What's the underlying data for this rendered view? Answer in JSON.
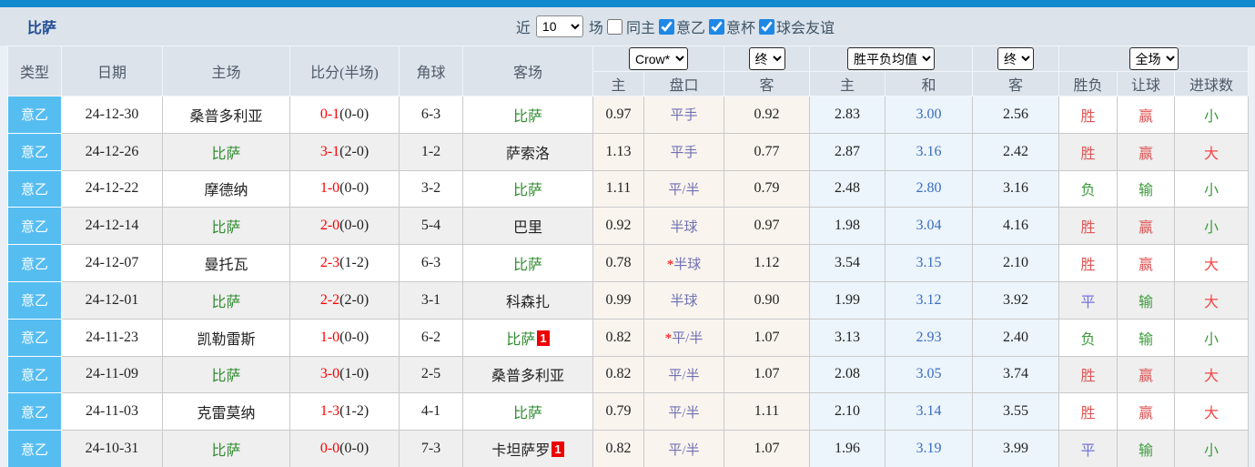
{
  "page": {
    "title": "比萨"
  },
  "filter_bar": {
    "recent_label": "近",
    "recent_value": "10",
    "matches_label": "场",
    "same_home_label": "同主",
    "same_home_checked": false,
    "leagues": [
      {
        "label": "意乙",
        "checked": true
      },
      {
        "label": "意杯",
        "checked": true
      },
      {
        "label": "球会友谊",
        "checked": true
      }
    ]
  },
  "header_controls": {
    "odds_source": "Crow*",
    "final_label_1": "终",
    "avg_label": "胜平负均值",
    "final_label_2": "终",
    "scope_label": "全场"
  },
  "table": {
    "main_headers": [
      "类型",
      "日期",
      "主场",
      "比分(半场)",
      "角球",
      "客场"
    ],
    "sub_headers": [
      "主",
      "盘口",
      "客",
      "主",
      "和",
      "客",
      "胜负",
      "让球",
      "进球数"
    ],
    "rows": [
      {
        "type": "意乙",
        "date": "24-12-30",
        "home": "桑普多利亚",
        "home_pisa": false,
        "home_badge": "",
        "score": "0-1",
        "half": "(0-0)",
        "corner": "6-3",
        "away": "比萨",
        "away_pisa": true,
        "away_badge": "",
        "odds_home": "0.97",
        "handicap": "平手",
        "handicap_star": false,
        "odds_away": "0.92",
        "avg_home": "2.83",
        "avg_draw": "3.00",
        "avg_away": "2.56",
        "result": "胜",
        "handicap_result": "赢",
        "goals_result": "小"
      },
      {
        "type": "意乙",
        "date": "24-12-26",
        "home": "比萨",
        "home_pisa": true,
        "home_badge": "",
        "score": "3-1",
        "half": "(2-0)",
        "corner": "1-2",
        "away": "萨索洛",
        "away_pisa": false,
        "away_badge": "",
        "odds_home": "1.13",
        "handicap": "平手",
        "handicap_star": false,
        "odds_away": "0.77",
        "avg_home": "2.87",
        "avg_draw": "3.16",
        "avg_away": "2.42",
        "result": "胜",
        "handicap_result": "赢",
        "goals_result": "大"
      },
      {
        "type": "意乙",
        "date": "24-12-22",
        "home": "摩德纳",
        "home_pisa": false,
        "home_badge": "",
        "score": "1-0",
        "half": "(0-0)",
        "corner": "3-2",
        "away": "比萨",
        "away_pisa": true,
        "away_badge": "",
        "odds_home": "1.11",
        "handicap": "平/半",
        "handicap_star": false,
        "odds_away": "0.79",
        "avg_home": "2.48",
        "avg_draw": "2.80",
        "avg_away": "3.16",
        "result": "负",
        "handicap_result": "输",
        "goals_result": "小"
      },
      {
        "type": "意乙",
        "date": "24-12-14",
        "home": "比萨",
        "home_pisa": true,
        "home_badge": "",
        "score": "2-0",
        "half": "(0-0)",
        "corner": "5-4",
        "away": "巴里",
        "away_pisa": false,
        "away_badge": "",
        "odds_home": "0.92",
        "handicap": "半球",
        "handicap_star": false,
        "odds_away": "0.97",
        "avg_home": "1.98",
        "avg_draw": "3.04",
        "avg_away": "4.16",
        "result": "胜",
        "handicap_result": "赢",
        "goals_result": "小"
      },
      {
        "type": "意乙",
        "date": "24-12-07",
        "home": "曼托瓦",
        "home_pisa": false,
        "home_badge": "",
        "score": "2-3",
        "half": "(1-2)",
        "corner": "6-3",
        "away": "比萨",
        "away_pisa": true,
        "away_badge": "",
        "odds_home": "0.78",
        "handicap": "半球",
        "handicap_star": true,
        "odds_away": "1.12",
        "avg_home": "3.54",
        "avg_draw": "3.15",
        "avg_away": "2.10",
        "result": "胜",
        "handicap_result": "赢",
        "goals_result": "大"
      },
      {
        "type": "意乙",
        "date": "24-12-01",
        "home": "比萨",
        "home_pisa": true,
        "home_badge": "",
        "score": "2-2",
        "half": "(2-0)",
        "corner": "3-1",
        "away": "科森扎",
        "away_pisa": false,
        "away_badge": "",
        "odds_home": "0.99",
        "handicap": "半球",
        "handicap_star": false,
        "odds_away": "0.90",
        "avg_home": "1.99",
        "avg_draw": "3.12",
        "avg_away": "3.92",
        "result": "平",
        "handicap_result": "输",
        "goals_result": "大"
      },
      {
        "type": "意乙",
        "date": "24-11-23",
        "home": "凯勒雷斯",
        "home_pisa": false,
        "home_badge": "",
        "score": "1-0",
        "half": "(0-0)",
        "corner": "6-2",
        "away": "比萨",
        "away_pisa": true,
        "away_badge": "1",
        "odds_home": "0.82",
        "handicap": "平/半",
        "handicap_star": true,
        "odds_away": "1.07",
        "avg_home": "3.13",
        "avg_draw": "2.93",
        "avg_away": "2.40",
        "result": "负",
        "handicap_result": "输",
        "goals_result": "小"
      },
      {
        "type": "意乙",
        "date": "24-11-09",
        "home": "比萨",
        "home_pisa": true,
        "home_badge": "",
        "score": "3-0",
        "half": "(1-0)",
        "corner": "2-5",
        "away": "桑普多利亚",
        "away_pisa": false,
        "away_badge": "",
        "odds_home": "0.82",
        "handicap": "平/半",
        "handicap_star": false,
        "odds_away": "1.07",
        "avg_home": "2.08",
        "avg_draw": "3.05",
        "avg_away": "3.74",
        "result": "胜",
        "handicap_result": "赢",
        "goals_result": "大"
      },
      {
        "type": "意乙",
        "date": "24-11-03",
        "home": "克雷莫纳",
        "home_pisa": false,
        "home_badge": "",
        "score": "1-3",
        "half": "(1-2)",
        "corner": "4-1",
        "away": "比萨",
        "away_pisa": true,
        "away_badge": "",
        "odds_home": "0.79",
        "handicap": "平/半",
        "handicap_star": false,
        "odds_away": "1.11",
        "avg_home": "2.10",
        "avg_draw": "3.14",
        "avg_away": "3.55",
        "result": "胜",
        "handicap_result": "赢",
        "goals_result": "大"
      },
      {
        "type": "意乙",
        "date": "24-10-31",
        "home": "比萨",
        "home_pisa": true,
        "home_badge": "",
        "score": "0-0",
        "half": "(0-0)",
        "corner": "7-3",
        "away": "卡坦萨罗",
        "away_pisa": false,
        "away_badge": "1",
        "odds_home": "0.82",
        "handicap": "平/半",
        "handicap_star": false,
        "odds_away": "1.07",
        "avg_home": "1.96",
        "avg_draw": "3.19",
        "avg_away": "3.99",
        "result": "平",
        "handicap_result": "输",
        "goals_result": "小"
      }
    ]
  },
  "colors": {
    "accent_blue": "#1189CE",
    "checkbox_blue": "#1E88E5",
    "league_tag_blue": "#56BDF1",
    "pisa_green": "#2F8B2F",
    "score_red": "#FF0000",
    "handicap_purple": "#7070B4",
    "draw_avg_blue": "#3A6BC4",
    "win_red": "#E05555",
    "lose_green": "#3E9B3E",
    "draw_violet": "#7373DE"
  }
}
